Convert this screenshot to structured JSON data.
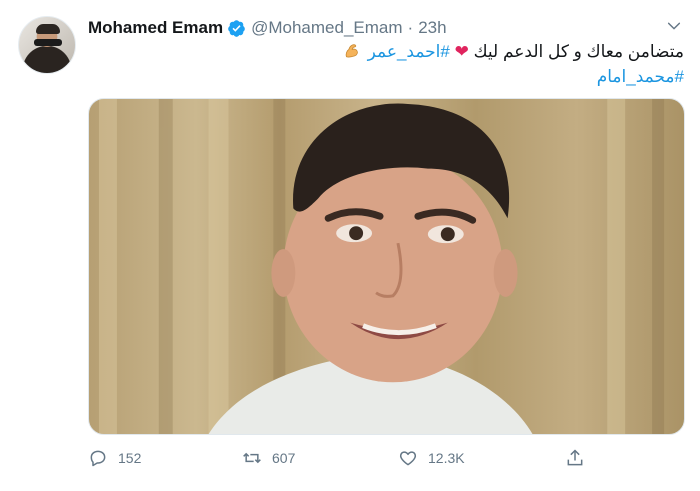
{
  "tweet": {
    "author_name": "Mohamed Emam",
    "handle": "@Mohamed_Emam",
    "separator": "·",
    "time": "23h",
    "verified_icon": "verified-badge-icon",
    "text_line1_main": "متضامن معاك و كل الدعم ليك",
    "text_line1_heart": "❤",
    "text_line1_hashtag": "#احمد_عمر",
    "text_line1_emoji": "flexed-biceps-icon",
    "text_line2_hashtag": "#محمد_امام",
    "hashtag_color": "#1b95e0",
    "heart_color": "#e0245e"
  },
  "actions": {
    "replies": "152",
    "retweets": "607",
    "likes": "12.3K",
    "icons": [
      "reply-icon",
      "retweet-icon",
      "like-icon",
      "share-icon"
    ],
    "icon_color": "#657786"
  }
}
